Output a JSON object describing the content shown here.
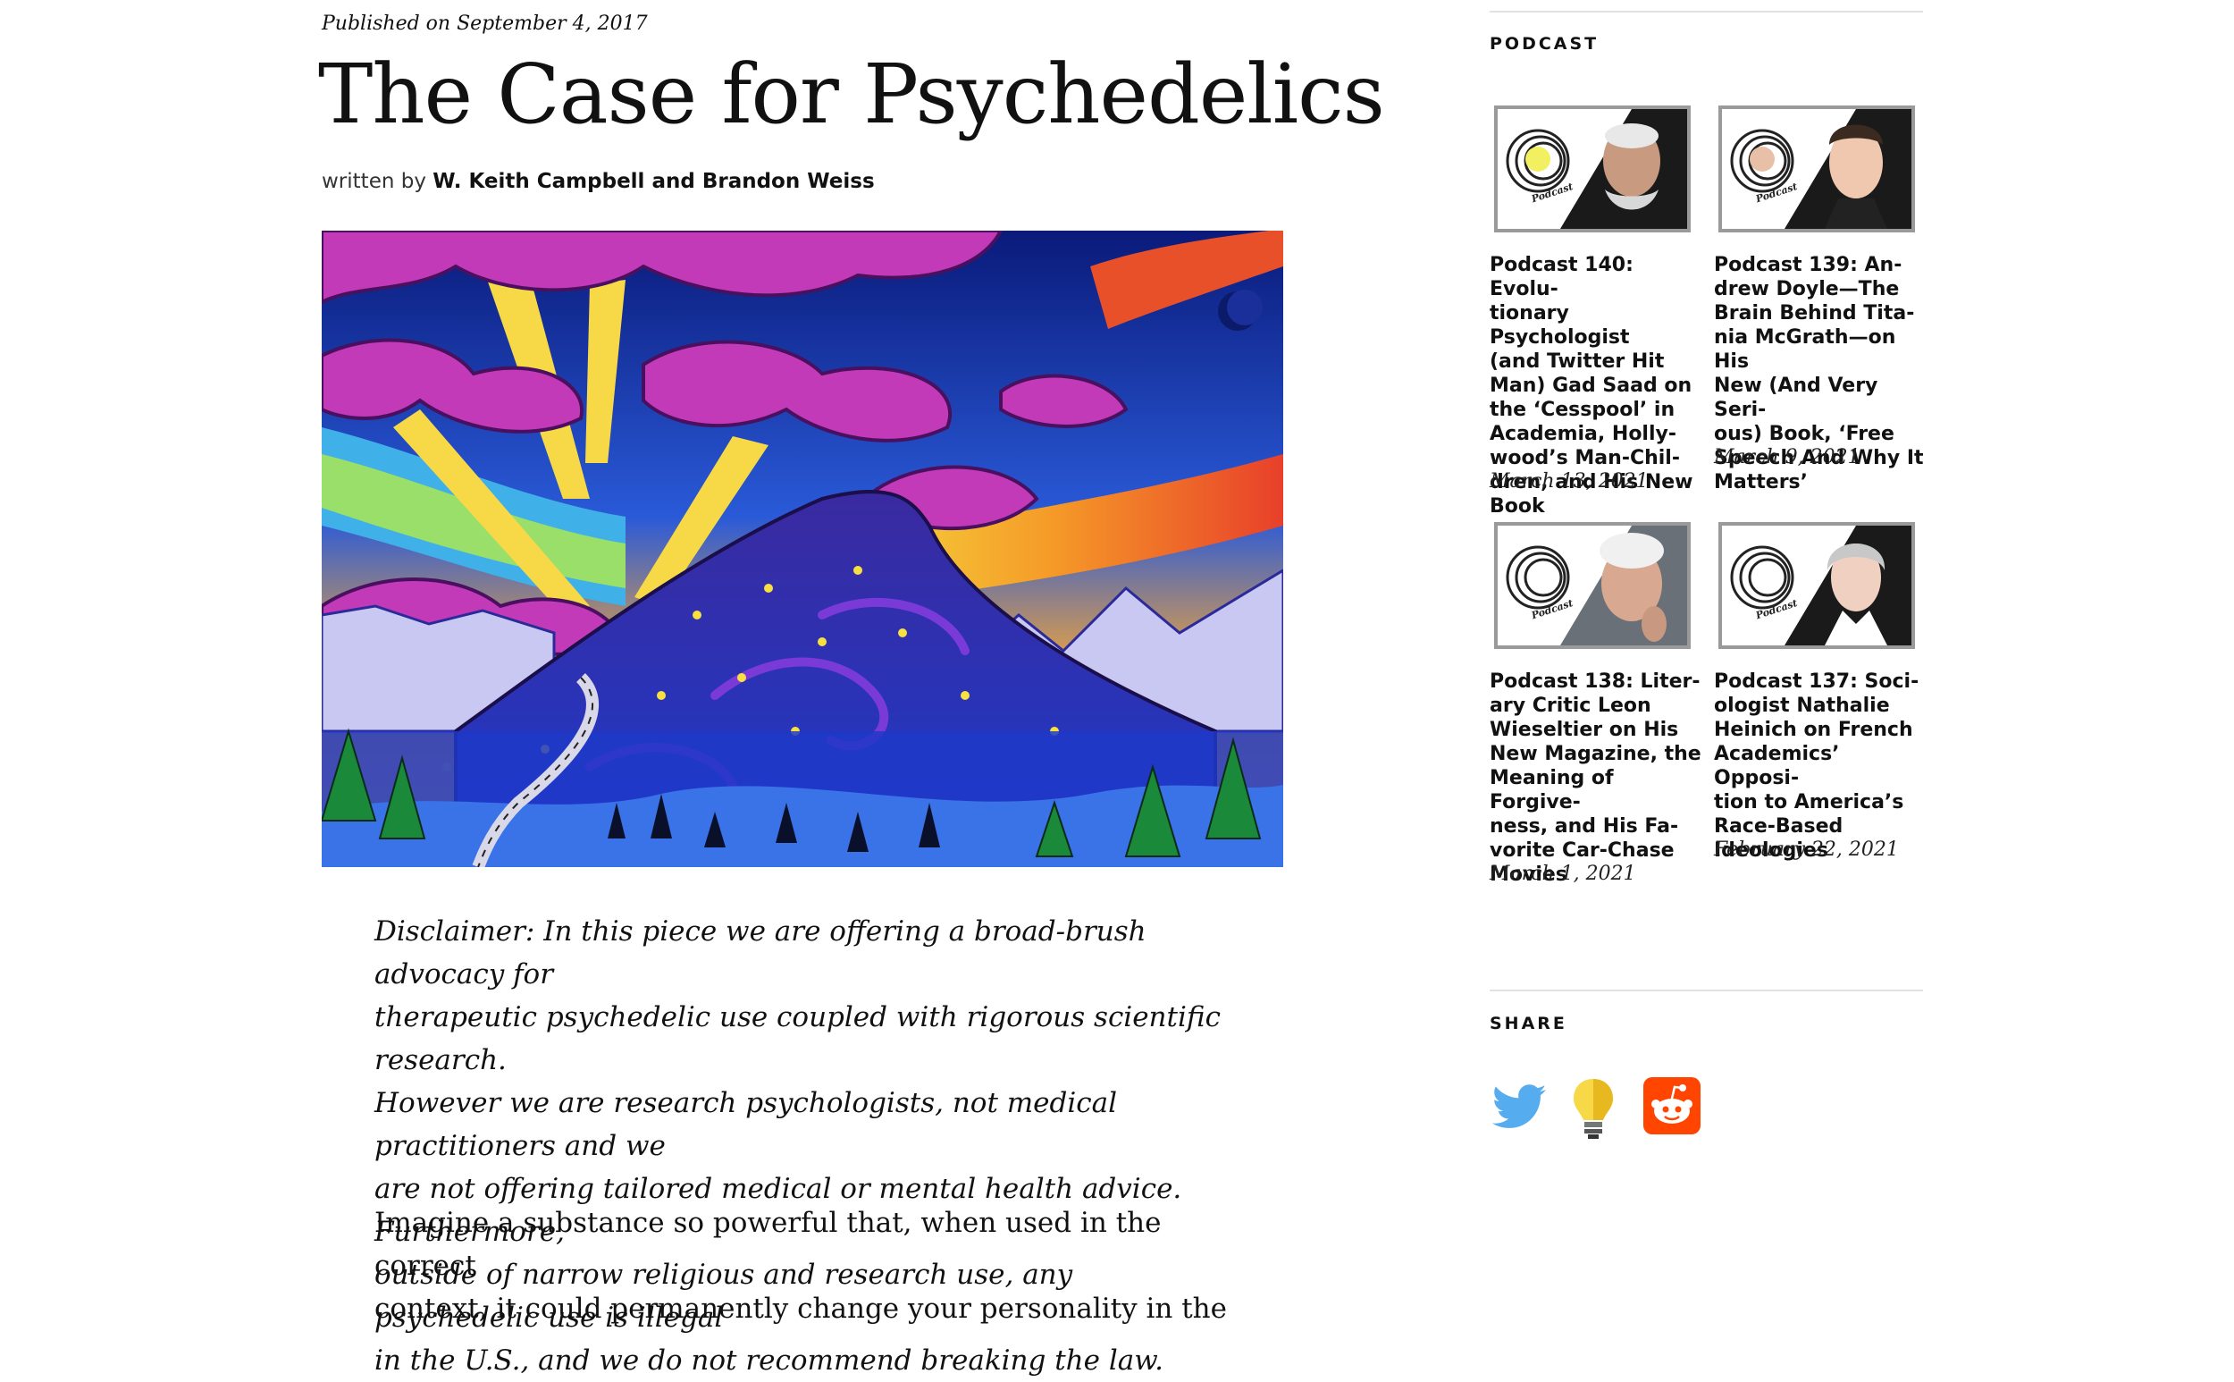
{
  "article": {
    "published": "Published on September 4, 2017",
    "title": "The Case for Psychedelics",
    "written_by": "written by",
    "authors": "W. Keith Campbell and Brandon Weiss",
    "disclaimer_lines": [
      "Disclaimer: In this piece we are offering a broad-brush advocacy for",
      "therapeutic psychedelic use coupled with rigorous scientific research.",
      "However we are research psychologists, not medical practitioners and we",
      "are not offering tailored medical or mental health advice. Furthermore,",
      "outside of narrow religious and research use, any psychedelic use is illegal",
      "in the U.S., and we do not recommend breaking the law."
    ],
    "intro_lines": [
      "Imagine a substance so powerful that, when used in the correct",
      "context, it could permanently change your personality in the"
    ]
  },
  "sidebar": {
    "podcast_heading": "PODCAST",
    "podcasts": [
      {
        "title_lines": [
          "Podcast 140: Evolu-",
          "tionary Psychologist",
          "(and Twitter Hit",
          "Man) Gad Saad on",
          "the ‘Cesspool’ in",
          "Academia, Holly-",
          "wood’s Man-Chil-",
          "dren, and His New",
          "Book"
        ],
        "date": "March 13, 2021"
      },
      {
        "title_lines": [
          "Podcast 139: An-",
          "drew Doyle—The",
          "Brain Behind Tita-",
          "nia McGrath—on His",
          "New (And Very Seri-",
          "ous) Book, ‘Free",
          "Speech And Why It",
          "Matters’"
        ],
        "date": "March 9, 2021"
      },
      {
        "title_lines": [
          "Podcast 138: Liter-",
          "ary Critic Leon",
          "Wieseltier on His",
          "New Magazine, the",
          "Meaning of Forgive-",
          "ness, and His Fa-",
          "vorite Car-Chase",
          "Movies"
        ],
        "date": "March 1, 2021"
      },
      {
        "title_lines": [
          "Podcast 137: Soci-",
          "ologist Nathalie",
          "Heinich on French",
          "Academics’ Opposi-",
          "tion to America’s",
          "Race-Based",
          "Ideologies"
        ],
        "date": "February 22, 2021"
      }
    ],
    "podcast_badge": "Podcast",
    "share_heading": "SHARE",
    "share_icons": [
      "twitter-icon",
      "lightbulb-icon",
      "reddit-icon"
    ]
  },
  "colors": {
    "twitter": "#55acee",
    "reddit": "#ff4500",
    "bulb": "#f7d948"
  }
}
